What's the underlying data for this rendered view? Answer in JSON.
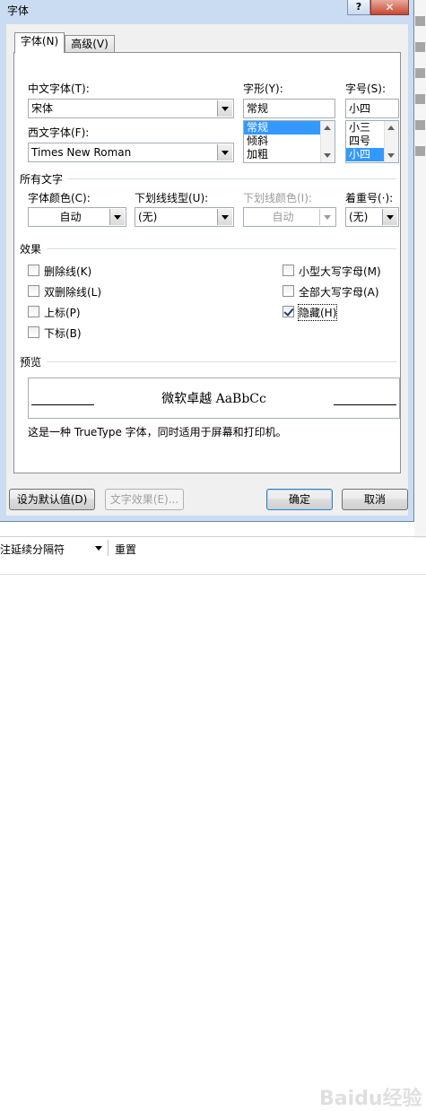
{
  "dialog": {
    "title": "字体",
    "help_label": "?",
    "close_label": "✕",
    "tabs": [
      "字体(N)",
      "高级(V)"
    ],
    "labels": {
      "chinese_font": "中文字体(T):",
      "western_font": "西文字体(F):",
      "style": "字形(Y):",
      "size": "字号(S):",
      "all_text": "所有文字",
      "font_color": "字体颜色(C):",
      "underline_style": "下划线线型(U):",
      "underline_color": "下划线颜色(I):",
      "emphasis": "着重号(·):",
      "effects": "效果",
      "preview": "预览"
    },
    "values": {
      "chinese_font": "宋体",
      "western_font": "Times New Roman",
      "style": "常规",
      "size": "小四",
      "font_color": "自动",
      "underline_style": "(无)",
      "underline_color": "自动",
      "emphasis": "(无)"
    },
    "style_list": [
      "常规",
      "倾斜",
      "加粗"
    ],
    "size_list": [
      "小三",
      "四号",
      "小四"
    ],
    "effects_left": [
      {
        "label": "删除线(K)",
        "checked": false
      },
      {
        "label": "双删除线(L)",
        "checked": false
      },
      {
        "label": "上标(P)",
        "checked": false
      },
      {
        "label": "下标(B)",
        "checked": false
      }
    ],
    "effects_right": [
      {
        "label": "小型大写字母(M)",
        "checked": false
      },
      {
        "label": "全部大写字母(A)",
        "checked": false
      },
      {
        "label": "隐藏(H)",
        "checked": true
      }
    ],
    "preview_text": "微软卓越  AaBbCc",
    "truetype_note": "这是一种 TrueType 字体，同时适用于屏幕和打印机。",
    "buttons": {
      "set_default": "设为默认值(D)",
      "text_effects": "文字效果(E)...",
      "ok": "确定",
      "cancel": "取消"
    }
  },
  "document": {
    "style_box_text": "注延续分隔符",
    "reset_label": "重置",
    "watermark": "Baidu经验"
  }
}
